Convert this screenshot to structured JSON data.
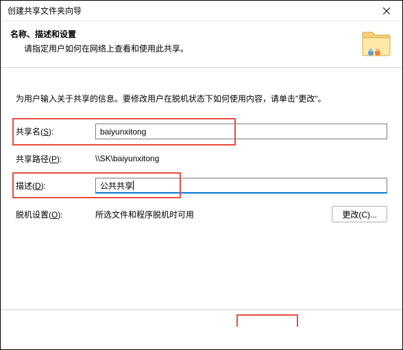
{
  "window": {
    "title": "创建共享文件夹向导"
  },
  "header": {
    "title": "名称、描述和设置",
    "subtitle": "请指定用户如何在网络上查看和使用此共享。"
  },
  "content": {
    "intro": "为用户输入关于共享的信息。要修改用户在脱机状态下如何使用内容，请单击\"更改\"。"
  },
  "fields": {
    "shareName": {
      "label_pre": "共享名(",
      "label_u": "S",
      "label_post": "):",
      "value": "baiyunxitong"
    },
    "sharePath": {
      "label_pre": "共享路径(",
      "label_u": "P",
      "label_post": "):",
      "value": "\\\\SK\\baiyunxitong"
    },
    "description": {
      "label_pre": "描述(",
      "label_u": "D",
      "label_post": "):",
      "value": "公共共享"
    },
    "offline": {
      "label_pre": "脱机设置(",
      "label_u": "O",
      "label_post": "):",
      "value": "所选文件和程序脱机时可用"
    }
  },
  "buttons": {
    "change": "更改(C)..."
  }
}
